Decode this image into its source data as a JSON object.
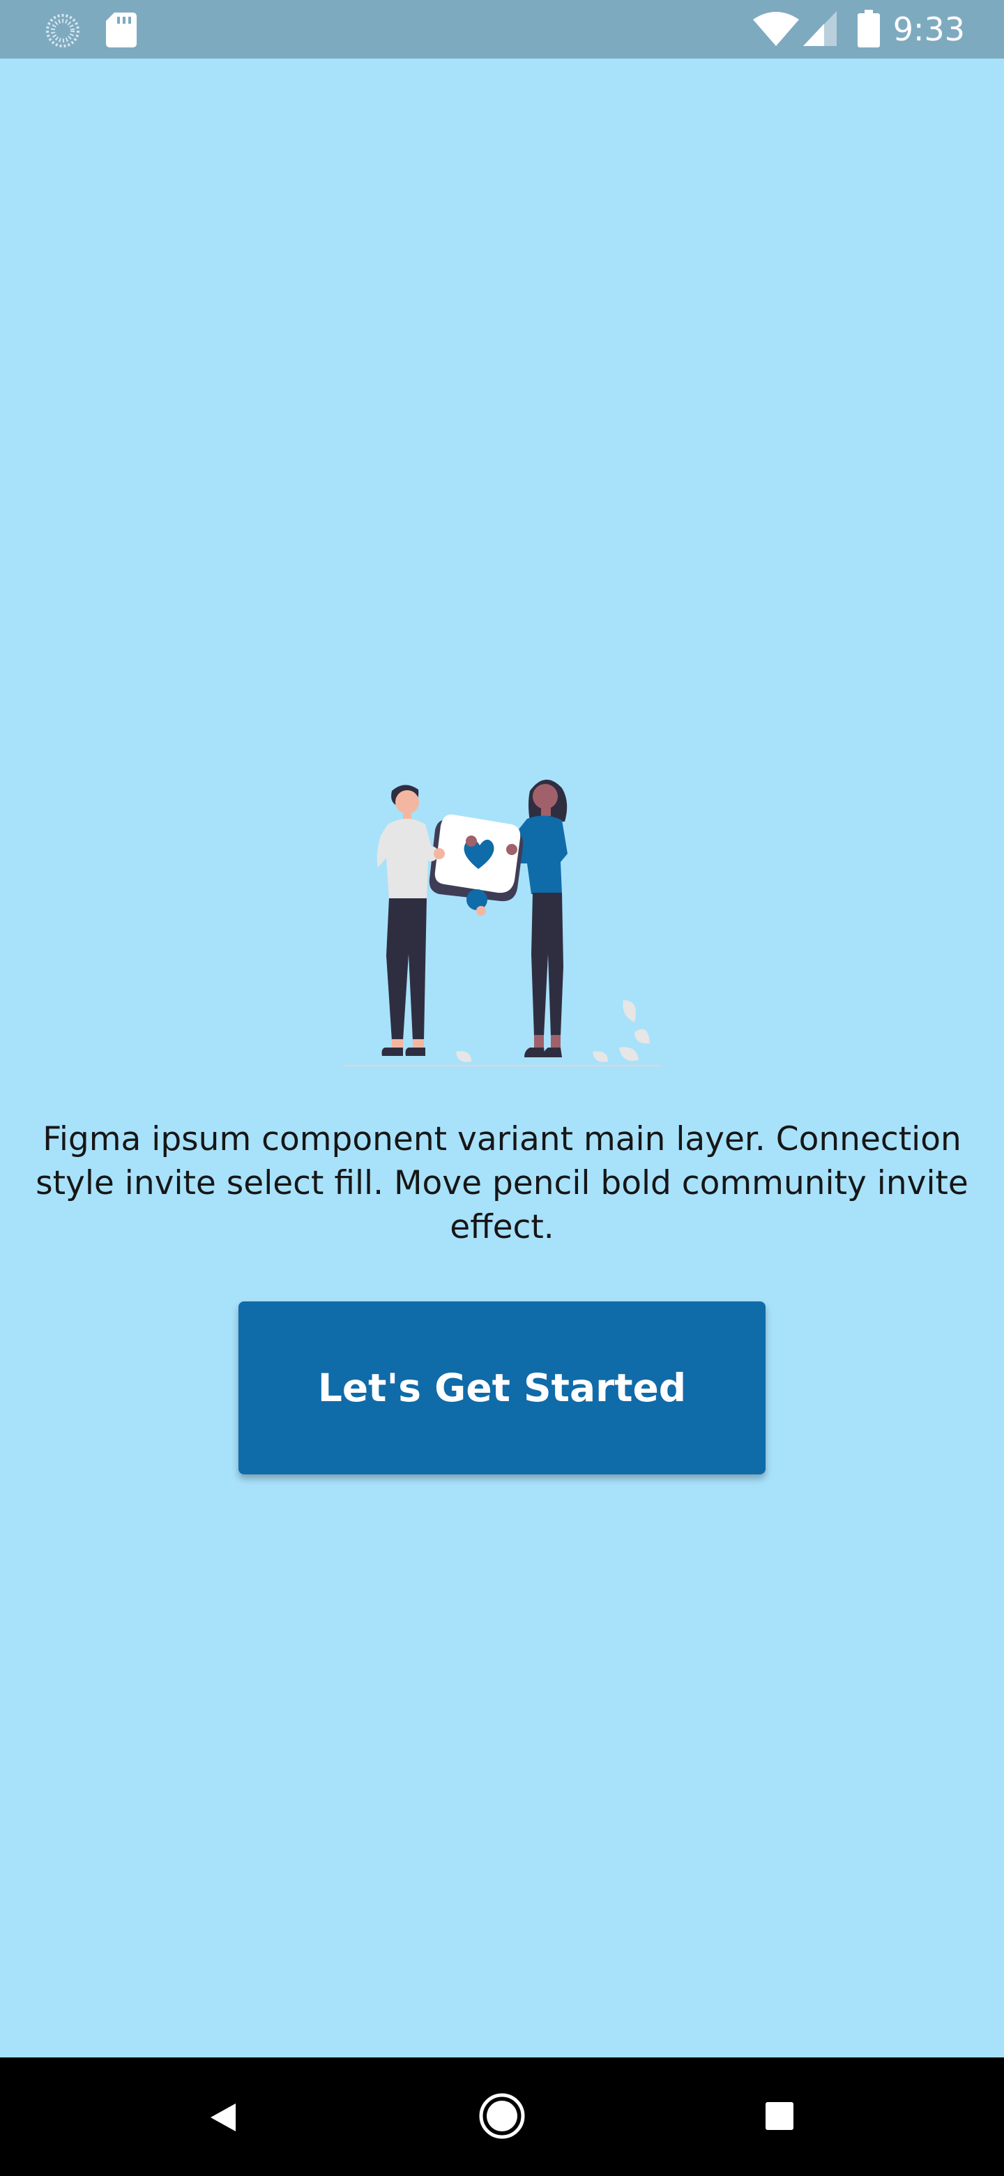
{
  "status_bar": {
    "time": "9:33",
    "icons": [
      "spinner-icon",
      "sd-card-icon",
      "wifi-icon",
      "cellular-signal-icon",
      "battery-icon"
    ]
  },
  "main": {
    "description": "Figma ipsum component variant main layer. Connection style invite select fill. Move pencil bold community invite effect.",
    "cta_label": "Let's Get Started"
  },
  "colors": {
    "background": "#a8e1fa",
    "status_bar": "#7eaac0",
    "accent": "#106ba9",
    "nav_bar": "#000000",
    "text": "#161616"
  },
  "nav_bar": {
    "buttons": [
      "back-icon",
      "home-icon",
      "recents-icon"
    ]
  }
}
